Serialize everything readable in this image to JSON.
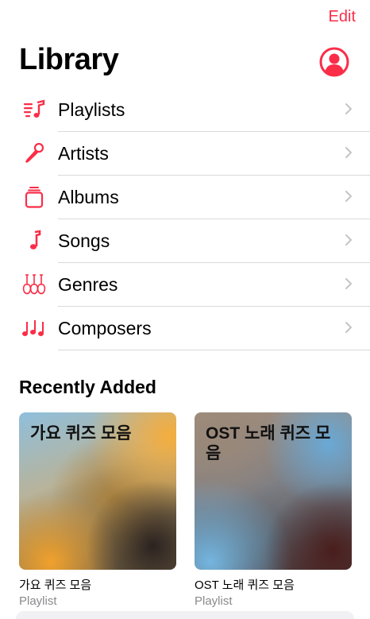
{
  "header": {
    "edit_label": "Edit",
    "title": "Library"
  },
  "menu": [
    {
      "label": "Playlists",
      "icon": "playlist-icon"
    },
    {
      "label": "Artists",
      "icon": "microphone-icon"
    },
    {
      "label": "Albums",
      "icon": "album-stack-icon"
    },
    {
      "label": "Songs",
      "icon": "music-note-icon"
    },
    {
      "label": "Genres",
      "icon": "guitars-icon"
    },
    {
      "label": "Composers",
      "icon": "notes-icon"
    }
  ],
  "recently_added": {
    "title": "Recently Added",
    "items": [
      {
        "art_title": "가요 퀴즈 모음",
        "name": "가요 퀴즈 모음",
        "type": "Playlist"
      },
      {
        "art_title": "OST 노래 퀴즈 모음",
        "name": "OST 노래 퀴즈 모음",
        "type": "Playlist"
      }
    ]
  },
  "colors": {
    "accent": "#fa2d48",
    "separator": "#d9d9dc",
    "secondary_text": "#8a8a8e"
  }
}
